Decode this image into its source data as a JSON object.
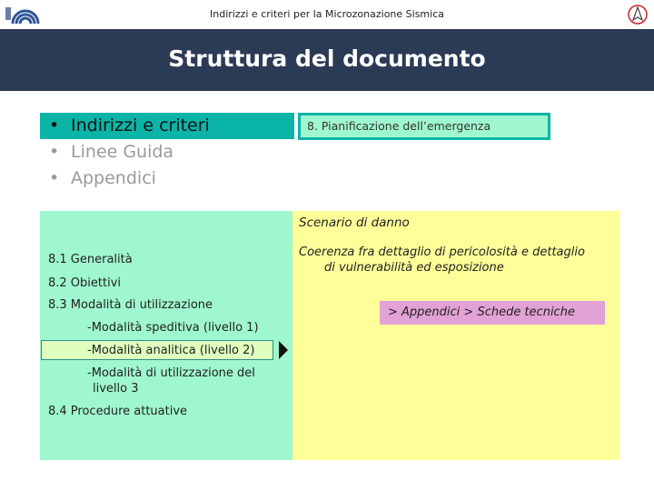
{
  "header": {
    "text": "Indirizzi e criteri per la Microzonazione Sismica"
  },
  "title": "Struttura del documento",
  "nav": {
    "items": [
      {
        "label": "Indirizzi e criteri"
      },
      {
        "label": "Linee Guida"
      },
      {
        "label": "Appendici"
      }
    ]
  },
  "section_chip": "8. Pianificazione dell’emergenza",
  "toc": {
    "generalita": "8.1 Generalità",
    "obiettivi": "8.2 Obiettivi",
    "modalita": "8.3 Modalità di utilizzazione",
    "livello1": "-Modalità speditiva (livello 1)",
    "livello2": "-Modalità analitica (livello 2)",
    "livello3_line1": "-Modalità di utilizzazione del",
    "livello3_line2": "livello 3",
    "procedure": "8.4 Procedure attuative"
  },
  "right": {
    "heading": "Scenario di danno",
    "desc_line1": "Coerenza fra dettaglio di pericolosità e dettaglio",
    "desc_line2": "di vulnerabilità ed esposizione",
    "link": "> Appendici > Schede tecniche"
  },
  "colors": {
    "title_bar": "#2b3a55",
    "accent_teal": "#0ab5a8",
    "panel_mint": "#9ff7cf",
    "panel_yellow": "#ffff99",
    "link_pink": "#e2a2d6"
  },
  "icons": {
    "left_logo": "arc-logo-icon",
    "right_logo": "compass-logo-icon"
  }
}
